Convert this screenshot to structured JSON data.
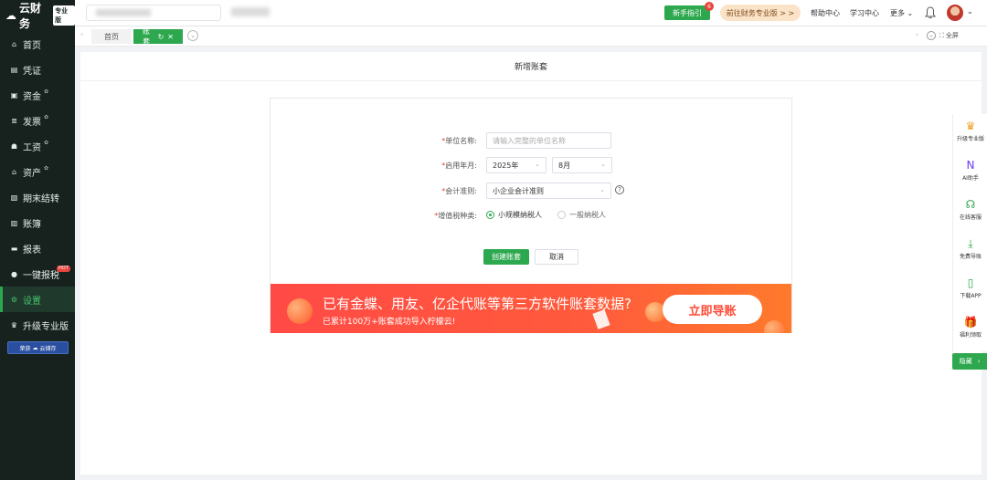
{
  "sidebar": {
    "brand": "云财务",
    "brand_badge": "专业版",
    "items": [
      {
        "label": "首页",
        "icon": "home-icon",
        "glyph": "⌂",
        "star": ""
      },
      {
        "label": "凭证",
        "icon": "voucher-icon",
        "glyph": "▤",
        "star": ""
      },
      {
        "label": "资金",
        "icon": "fund-icon",
        "glyph": "▣",
        "star": "✿"
      },
      {
        "label": "发票",
        "icon": "invoice-icon",
        "glyph": "≣",
        "star": "✿"
      },
      {
        "label": "工资",
        "icon": "salary-icon",
        "glyph": "☗",
        "star": "✿"
      },
      {
        "label": "资产",
        "icon": "asset-icon",
        "glyph": "⌂",
        "star": "✿"
      },
      {
        "label": "期末结转",
        "icon": "period-close-icon",
        "glyph": "▧",
        "star": ""
      },
      {
        "label": "账簿",
        "icon": "ledger-icon",
        "glyph": "▥",
        "star": ""
      },
      {
        "label": "报表",
        "icon": "report-icon",
        "glyph": "▬",
        "star": ""
      },
      {
        "label": "一键报税",
        "icon": "tax-icon",
        "glyph": "●",
        "star": ""
      },
      {
        "label": "设置",
        "icon": "settings-icon",
        "glyph": "⚙",
        "star": ""
      },
      {
        "label": "升级专业版",
        "icon": "crown-icon",
        "glyph": "♛",
        "star": ""
      }
    ],
    "hot_badge": "HOT",
    "storage_badge_left": "荣获",
    "storage_badge_right": "云储存"
  },
  "topbar": {
    "guide_button": "新手指引",
    "guide_count": "6",
    "pro_link": "前往财务专业版 > >",
    "links": [
      "帮助中心",
      "学习中心",
      "更多"
    ],
    "more_chevron": "⌄"
  },
  "tabs": {
    "home": "首页",
    "current": "账套",
    "fullscreen": "全屏"
  },
  "page": {
    "title": "新增账套"
  },
  "form": {
    "unit_name": {
      "label": "单位名称:",
      "placeholder": "请输入完整的单位名称"
    },
    "start_period": {
      "label": "启用年月:",
      "year": "2025年",
      "month": "8月"
    },
    "standard": {
      "label": "会计准则:",
      "value": "小企业会计准则"
    },
    "vat_type": {
      "label": "增值税种类:",
      "options": [
        "小规模纳税人",
        "一般纳税人"
      ],
      "selected": 0
    },
    "required_mark": "*",
    "create_button": "创建账套",
    "cancel_button": "取消"
  },
  "banner": {
    "title": "已有金蝶、用友、亿企代账等第三方软件账套数据?",
    "subtitle": "已累计100万+账套成功导入柠檬云!",
    "button": "立即导账"
  },
  "rightbar": {
    "items": [
      {
        "label": "升级专业版",
        "icon": "crown-icon",
        "glyph": "♛",
        "color": "#f0a020"
      },
      {
        "label": "AI助手",
        "icon": "ai-icon",
        "glyph": "N",
        "color": "#6a3df0"
      },
      {
        "label": "在线客服",
        "icon": "headset-icon",
        "glyph": "☊",
        "color": "#2ea84f"
      },
      {
        "label": "免费导账",
        "icon": "download-icon",
        "glyph": "⤓",
        "color": "#2ea84f"
      },
      {
        "label": "下载APP",
        "icon": "phone-icon",
        "glyph": "▯",
        "color": "#2ea84f"
      },
      {
        "label": "福利领取",
        "icon": "gift-icon",
        "glyph": "🎁",
        "color": "#f0a020"
      }
    ],
    "hide_button": "隐藏"
  },
  "colors": {
    "accent": "#2ea84f",
    "sidebar_bg": "#17221e",
    "banner": "#ff4a45"
  }
}
